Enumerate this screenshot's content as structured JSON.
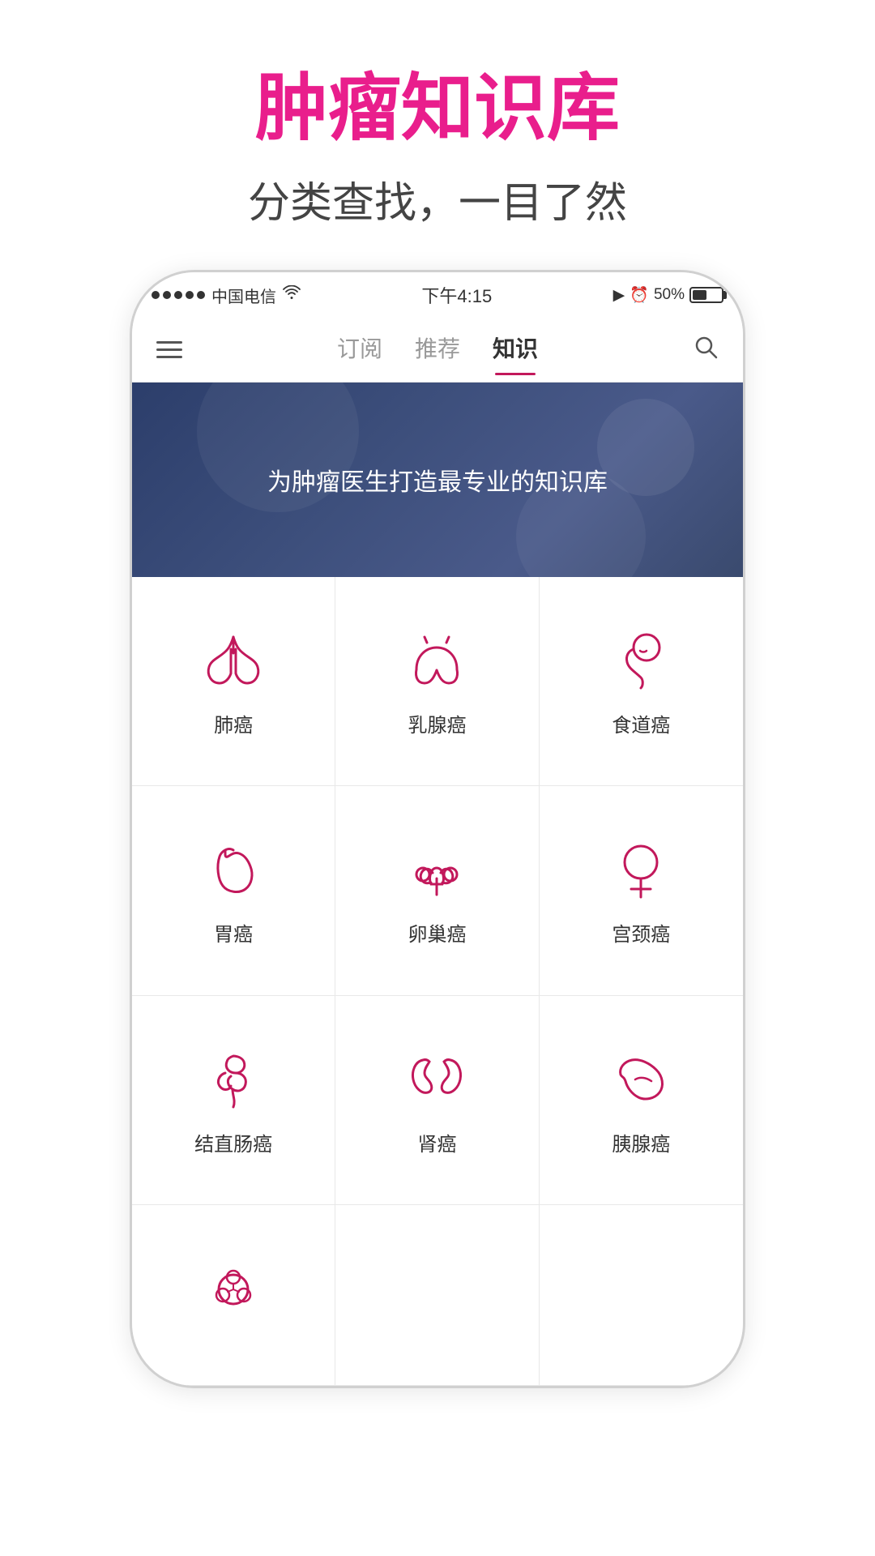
{
  "page": {
    "title_main": "肿瘤知识库",
    "title_sub": "分类查找，一目了然"
  },
  "status_bar": {
    "carrier": "中国电信",
    "time": "下午4:15",
    "battery": "50%"
  },
  "nav": {
    "tabs": [
      {
        "label": "订阅",
        "active": false
      },
      {
        "label": "推荐",
        "active": false
      },
      {
        "label": "知识",
        "active": true
      }
    ]
  },
  "banner": {
    "text": "为肿瘤医生打造最专业的知识库"
  },
  "categories": [
    {
      "id": "lung",
      "label": "肺癌",
      "icon": "lung"
    },
    {
      "id": "breast",
      "label": "乳腺癌",
      "icon": "breast"
    },
    {
      "id": "esophagus",
      "label": "食道癌",
      "icon": "esophagus"
    },
    {
      "id": "stomach",
      "label": "胃癌",
      "icon": "stomach"
    },
    {
      "id": "ovary",
      "label": "卵巢癌",
      "icon": "ovary"
    },
    {
      "id": "cervix",
      "label": "宫颈癌",
      "icon": "cervix"
    },
    {
      "id": "colorectal",
      "label": "结直肠癌",
      "icon": "colorectal"
    },
    {
      "id": "kidney",
      "label": "肾癌",
      "icon": "kidney"
    },
    {
      "id": "pancreas",
      "label": "胰腺癌",
      "icon": "pancreas"
    },
    {
      "id": "lymph",
      "label": "",
      "icon": "lymph"
    }
  ],
  "colors": {
    "accent": "#e91e8c",
    "icon_color": "#c2185b",
    "nav_active": "#c2185b",
    "banner_bg_start": "#2c3e6b",
    "banner_bg_end": "#4a5a8a"
  }
}
